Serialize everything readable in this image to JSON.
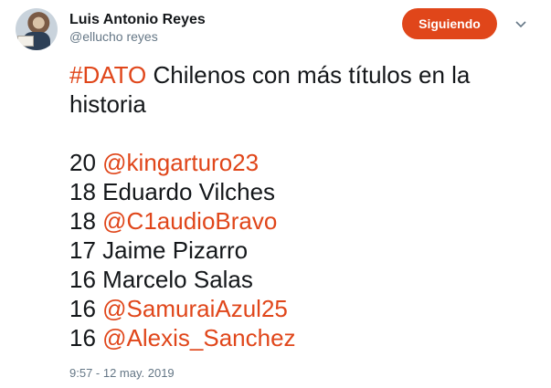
{
  "author": {
    "name": "Luis Antonio Reyes",
    "handle": "@ellucho reyes"
  },
  "follow_button": {
    "label": "Siguiendo"
  },
  "tweet": {
    "hashtag": "#DATO",
    "title_rest": " Chilenos con más títulos en la",
    "title_line2": "historia",
    "rows": [
      {
        "count": "20",
        "name": "@kingarturo23",
        "is_mention": true
      },
      {
        "count": "18",
        "name": "Eduardo Vilches",
        "is_mention": false
      },
      {
        "count": "18",
        "name": "@C1audioBravo",
        "is_mention": true
      },
      {
        "count": "17",
        "name": "Jaime Pizarro",
        "is_mention": false
      },
      {
        "count": "16",
        "name": "Marcelo Salas",
        "is_mention": false
      },
      {
        "count": "16",
        "name": "@SamuraiAzul25",
        "is_mention": true
      },
      {
        "count": "16",
        "name": "@Alexis_Sanchez",
        "is_mention": true
      }
    ]
  },
  "timestamp": "9:57 - 12 may. 2019",
  "colors": {
    "accent": "#e0461a",
    "secondary_text": "#657786"
  },
  "icons": {
    "menu": "chevron-down-icon"
  }
}
